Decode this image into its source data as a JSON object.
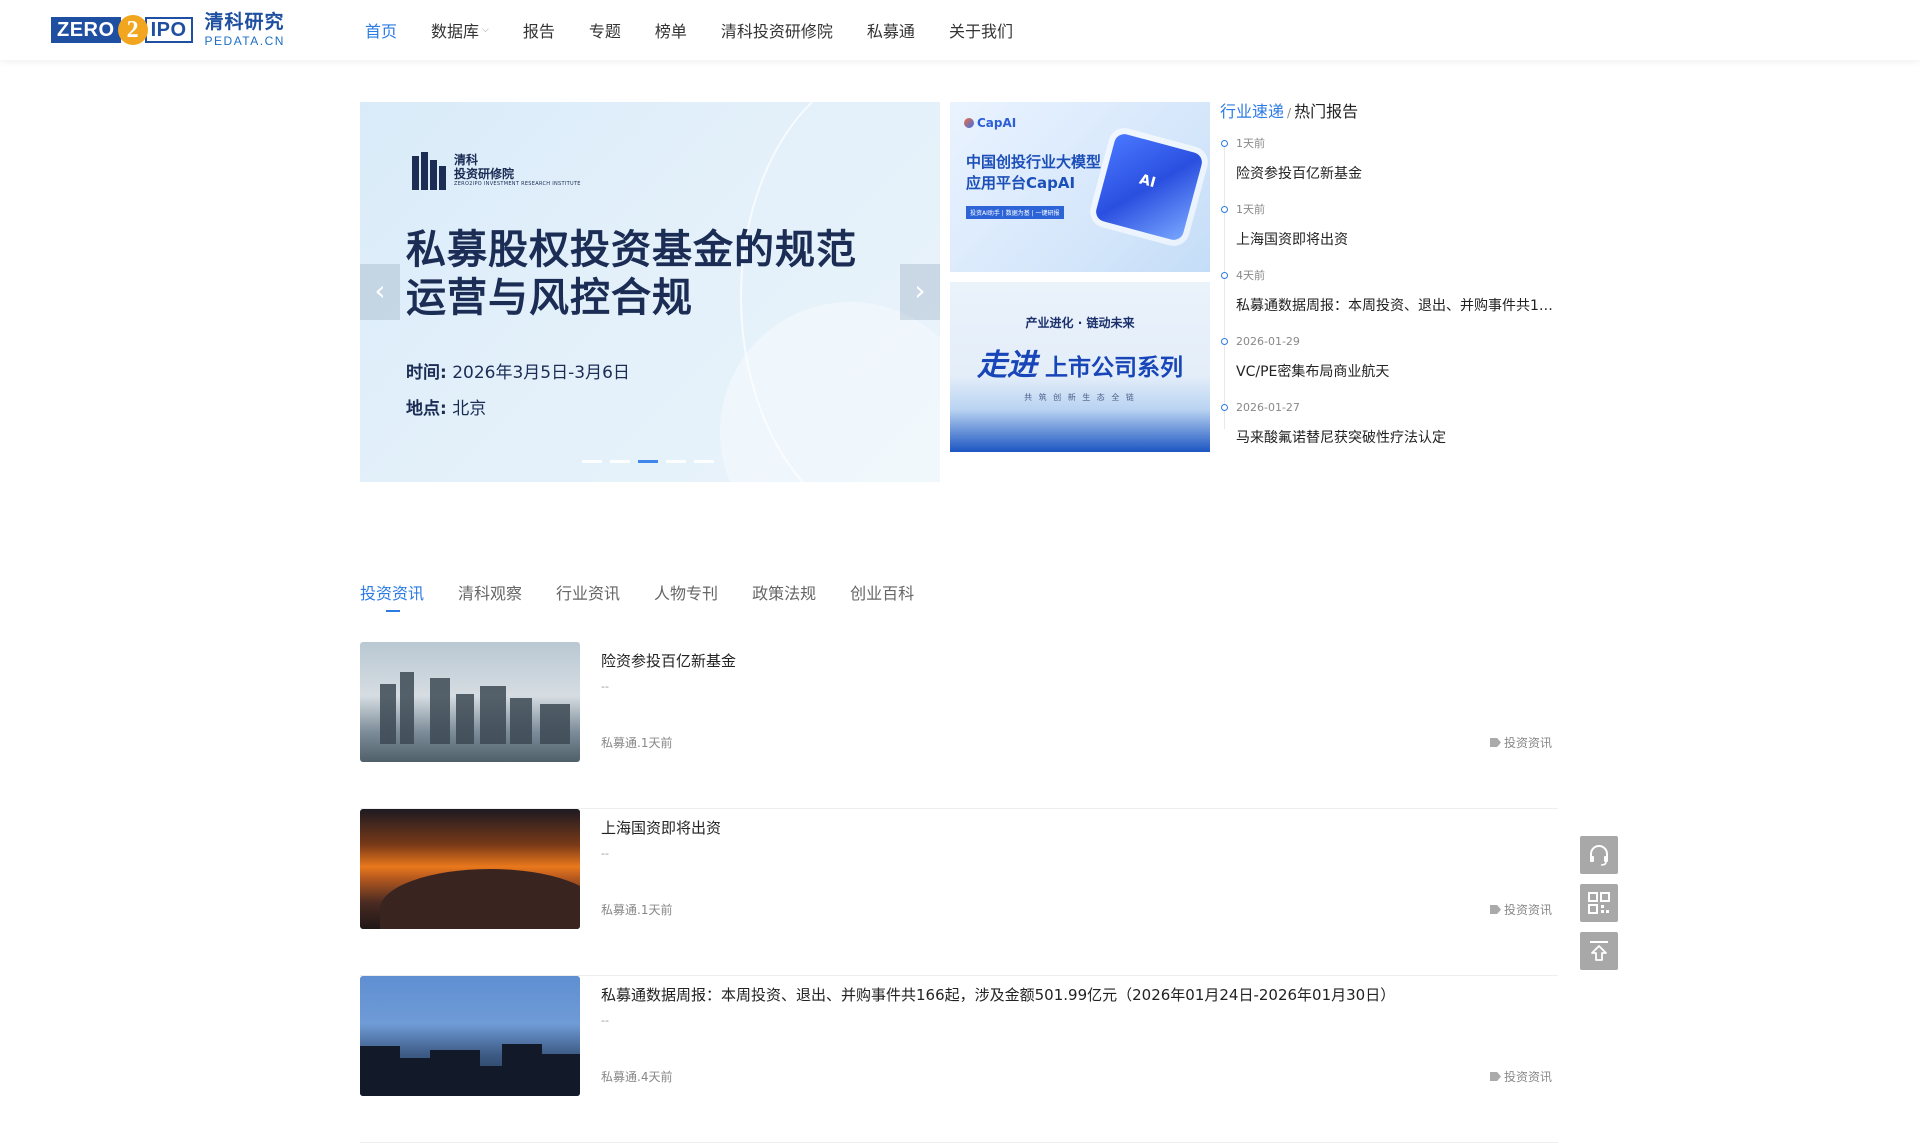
{
  "header": {
    "logo": {
      "mark_left": "ZERO",
      "mark_digit": "2",
      "mark_right": "IPO",
      "cn": "清科研究",
      "en": "PEDATA.CN"
    },
    "nav": [
      {
        "label": "首页",
        "active": true
      },
      {
        "label": "数据库",
        "dropdown": true
      },
      {
        "label": "报告"
      },
      {
        "label": "专题"
      },
      {
        "label": "榜单"
      },
      {
        "label": "清科投资研修院"
      },
      {
        "label": "私募通"
      },
      {
        "label": "关于我们"
      }
    ]
  },
  "banner": {
    "institute_cn1": "清科",
    "institute_cn2": "投资研修院",
    "institute_en": "ZERO2IPO INVESTMENT RESEARCH INSTITUTE",
    "title_line1": "私募股权投资基金的规范",
    "title_line2": "运营与风控合规",
    "time_label": "时间:",
    "time_value": "2026年3月5日-3月6日",
    "place_label": "地点:",
    "place_value": "北京",
    "prev_icon": "chevron-left-icon",
    "next_icon": "chevron-right-icon",
    "slide_count": 5,
    "active_slide": 3
  },
  "promos": [
    {
      "brand": "CapAI",
      "title_line1": "中国创投行业大模型",
      "title_line2": "应用平台CapAI",
      "tag": "投资AI助手 | 数据为基 | 一键研报",
      "cube_label": "AI"
    },
    {
      "subtitle": "产业进化 · 链动未来",
      "title_script": "走进",
      "title": "上市公司系列",
      "footer": "共 筑 创 新 生 态 全 链"
    }
  ],
  "hot": {
    "tab_active": "行业速递",
    "separator": "/",
    "tab_other": "热门报告",
    "items": [
      {
        "time": "1天前",
        "title": "险资参投百亿新基金"
      },
      {
        "time": "1天前",
        "title": "上海国资即将出资"
      },
      {
        "time": "4天前",
        "title": "私募通数据周报：本周投资、退出、并购事件共16..."
      },
      {
        "time": "2026-01-29",
        "title": "VC/PE密集布局商业航天"
      },
      {
        "time": "2026-01-27",
        "title": "马来酸氟诺替尼获突破性疗法认定"
      }
    ]
  },
  "tabs": [
    {
      "label": "投资资讯",
      "active": true
    },
    {
      "label": "清科观察"
    },
    {
      "label": "行业资讯"
    },
    {
      "label": "人物专刊"
    },
    {
      "label": "政策法规"
    },
    {
      "label": "创业百科"
    }
  ],
  "articles": [
    {
      "title": "险资参投百亿新基金",
      "desc": "--",
      "meta": "私募通.1天前",
      "tag": "投资资讯"
    },
    {
      "title": "上海国资即将出资",
      "desc": "--",
      "meta": "私募通.1天前",
      "tag": "投资资讯"
    },
    {
      "title": "私募通数据周报：本周投资、退出、并购事件共166起，涉及金额501.99亿元（2026年01月24日-2026年01月30日）",
      "desc": "--",
      "meta": "私募通.4天前",
      "tag": "投资资讯"
    }
  ],
  "side_tools": [
    {
      "icon": "headset-icon"
    },
    {
      "icon": "qrcode-icon"
    },
    {
      "icon": "back-to-top-icon"
    }
  ],
  "colors": {
    "accent": "#2c7be5",
    "brand": "#1e4fa0",
    "logo_orange": "#f2a61f"
  }
}
